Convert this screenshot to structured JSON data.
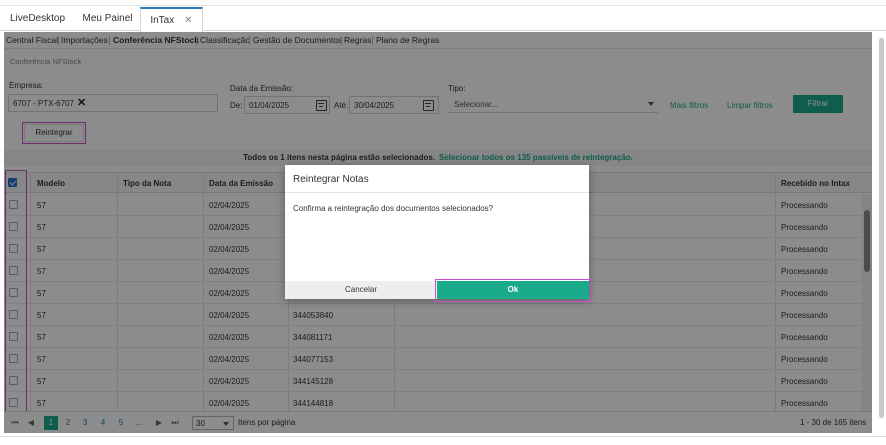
{
  "tabs": [
    {
      "label": "LiveDesktop"
    },
    {
      "label": "Meu Painel"
    },
    {
      "label": "InTax",
      "close": "✕"
    }
  ],
  "menu": [
    "Central Fiscal",
    "Importações",
    "Conferência NFStock",
    "Classificação",
    "Gestão de Documentos",
    "Regras",
    "Plano de Regras"
  ],
  "breadcrumb": "Conferência NFStock",
  "filters": {
    "empresa_label": "Empresa:",
    "empresa_value": "6707 - PTX-6707",
    "data_label": "Data da Emissão:",
    "de_label": "De:",
    "de_value": "01/04/2025",
    "ate_label": "Até:",
    "ate_value": "30/04/2025",
    "tipo_label": "Tipo:",
    "tipo_placeholder": "Selecionar...",
    "mais_filtros": "Mais filtros",
    "limpar_filtros": "Limpar filtros",
    "filtrar": "Filtrar"
  },
  "reintegrar_label": "Reintegrar",
  "selection_bar": {
    "text": "Todos os 1 itens nesta página estão selecionados.",
    "link": "Selecionar todos os 135 passíveis de reintegração."
  },
  "grid": {
    "headers": [
      "Modelo",
      "Tipo da Nota",
      "Data da Emissão",
      "Recebido no Intax"
    ],
    "rows": [
      {
        "modelo": "57",
        "data": "02/04/2025",
        "numero": "",
        "recebido": "Processando"
      },
      {
        "modelo": "57",
        "data": "02/04/2025",
        "numero": "",
        "recebido": "Processando"
      },
      {
        "modelo": "57",
        "data": "02/04/2025",
        "numero": "",
        "recebido": "Processando"
      },
      {
        "modelo": "57",
        "data": "02/04/2025",
        "numero": "",
        "recebido": "Processando"
      },
      {
        "modelo": "57",
        "data": "02/04/2025",
        "numero": "",
        "recebido": "Processando"
      },
      {
        "modelo": "57",
        "data": "02/04/2025",
        "numero": "344053840",
        "recebido": "Processando"
      },
      {
        "modelo": "57",
        "data": "02/04/2025",
        "numero": "344081171",
        "recebido": "Processando"
      },
      {
        "modelo": "57",
        "data": "02/04/2025",
        "numero": "344077153",
        "recebido": "Processando"
      },
      {
        "modelo": "57",
        "data": "02/04/2025",
        "numero": "344145128",
        "recebido": "Processando"
      },
      {
        "modelo": "57",
        "data": "02/04/2025",
        "numero": "344144818",
        "recebido": "Processando"
      }
    ]
  },
  "pager": {
    "pages": [
      "1",
      "2",
      "3",
      "4",
      "5",
      "..."
    ],
    "page_size": "30",
    "items_label": "Itens por página",
    "summary": "1 - 30 de 165 itens"
  },
  "dialog": {
    "title": "Reintegrar Notas",
    "message": "Confirma a reintegração dos documentos selecionados?",
    "cancel": "Cancelar",
    "ok": "Ok"
  },
  "colors": {
    "accent": "#1aaa8c",
    "highlight": "#c94fc9",
    "checkbox": "#2a6fd0"
  }
}
